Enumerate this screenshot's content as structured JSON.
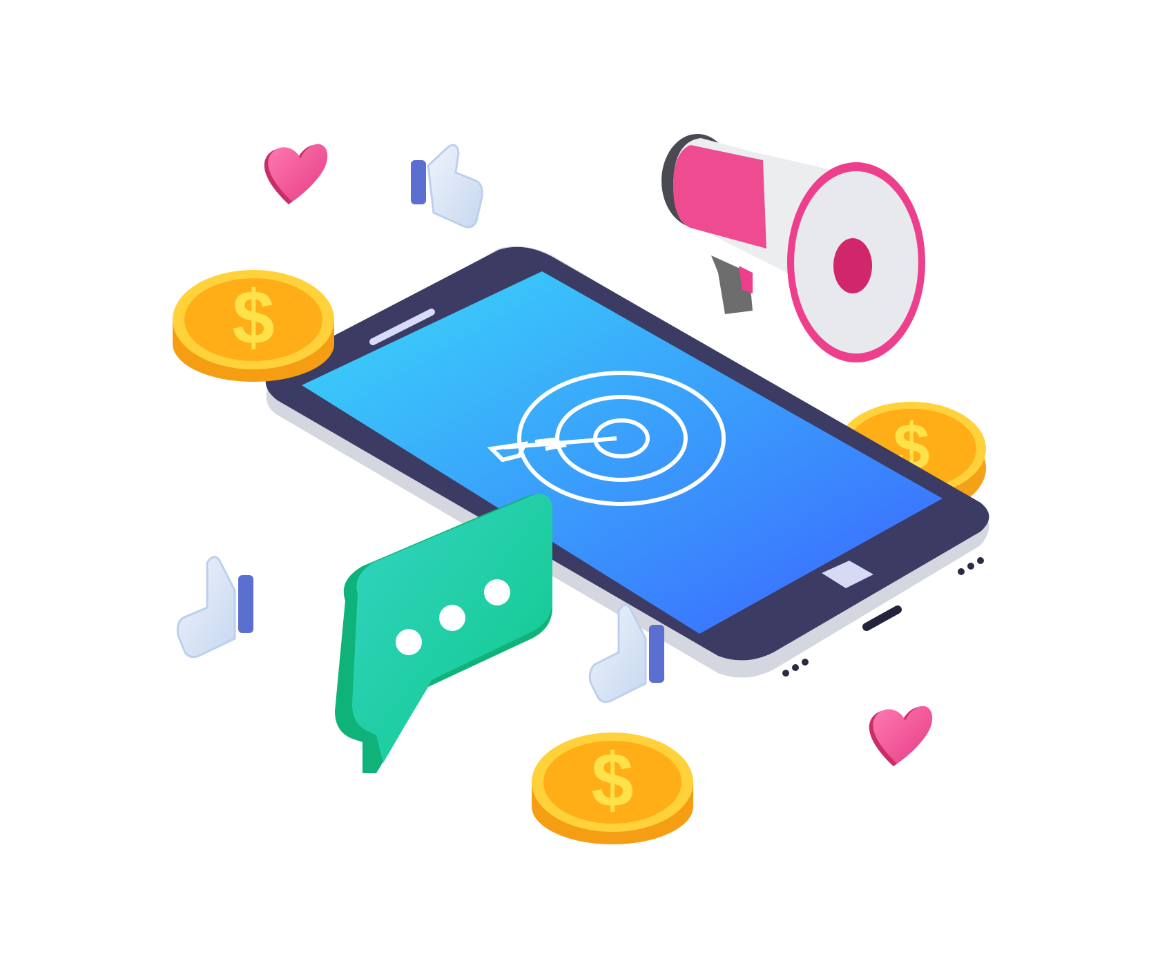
{
  "illustration": {
    "subject": "smartphone-marketing",
    "elements": {
      "phone": {
        "icon": "target-with-arrow-icon",
        "screen_gradient": [
          "#3ad7f7",
          "#3b6cff"
        ],
        "body_color": "#3b3b63"
      },
      "megaphone": {
        "icon": "megaphone-icon",
        "accent": "#ee3f8c"
      },
      "speech_bubble": {
        "icon": "chat-bubble-icon",
        "color": "#19c8a2"
      },
      "coins": {
        "count": 3,
        "icon": "dollar-coin-icon",
        "color": "#ffa914"
      },
      "hearts": {
        "count": 2,
        "icon": "heart-icon",
        "color": "#ee4b8c"
      },
      "thumbs_up": {
        "count": 3,
        "icon": "thumbs-up-icon",
        "accent": "#5b6fd0"
      }
    }
  }
}
